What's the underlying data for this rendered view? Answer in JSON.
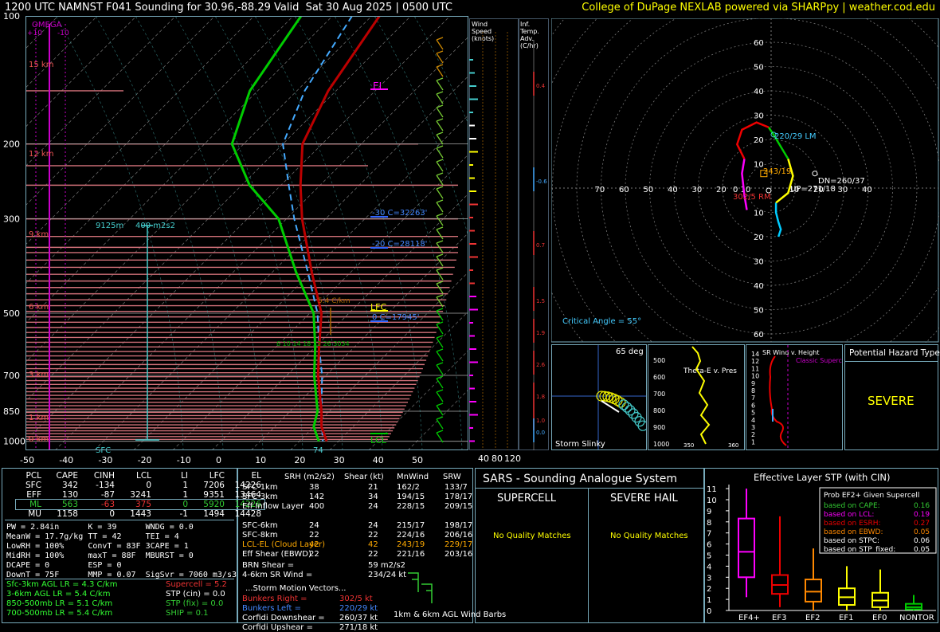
{
  "header": {
    "title": "1200 UTC NAMNST F041 Sounding for 30.96,-88.29 Valid  Sat 30 Aug 2025 | 0500 UTC",
    "credit": "College of DuPage NEXLAB powered via SHARPpy | weather.cod.edu"
  },
  "skewt": {
    "omega_label": "OMEGA",
    "omega_ticks": [
      "+10",
      "-10"
    ],
    "pressure_ticks": [
      "100",
      "200",
      "300",
      "500",
      "700",
      "850",
      "1000"
    ],
    "temp_ticks": [
      "-50",
      "-40",
      "-30",
      "-20",
      "-10",
      "0",
      "10",
      "20",
      "30",
      "40",
      "50"
    ],
    "height_labels": [
      "15 km",
      "12 km",
      "9 km",
      "6 km",
      "3 km",
      "1 km",
      "0 km"
    ],
    "annotations": {
      "el": "EL",
      "lfc": "LFC",
      "lcl": "LCL",
      "m30": "-30 C=32263'",
      "m20": "-20 C=28118'",
      "zero": "0 C=17945'",
      "lapse": "5.4 C/km",
      "eff_inflow_top": "9125m",
      "eff_inflow_srh": "400 m2s2",
      "sfc": "SFC",
      "sfc_temp": "74",
      "wet_bulb_ticks": "6  10  14  18  22 26 3034"
    },
    "temperature": [
      [
        100,
        -68
      ],
      [
        150,
        -62
      ],
      [
        200,
        -55
      ],
      [
        250,
        -45
      ],
      [
        300,
        -36
      ],
      [
        400,
        -20
      ],
      [
        500,
        -7
      ],
      [
        600,
        1
      ],
      [
        700,
        8
      ],
      [
        850,
        18
      ],
      [
        925,
        22
      ],
      [
        1000,
        27
      ]
    ],
    "dewpoint": [
      [
        100,
        -88
      ],
      [
        150,
        -82
      ],
      [
        200,
        -73
      ],
      [
        250,
        -58
      ],
      [
        300,
        -42
      ],
      [
        400,
        -24
      ],
      [
        500,
        -9
      ],
      [
        600,
        0
      ],
      [
        700,
        7
      ],
      [
        850,
        17
      ],
      [
        925,
        20
      ],
      [
        1000,
        25
      ]
    ],
    "parcel": [
      [
        100,
        -75
      ],
      [
        150,
        -68
      ],
      [
        200,
        -60
      ],
      [
        250,
        -48
      ],
      [
        300,
        -38
      ],
      [
        400,
        -21
      ],
      [
        500,
        -8
      ],
      [
        600,
        1
      ],
      [
        700,
        9
      ],
      [
        850,
        18
      ],
      [
        1000,
        26
      ]
    ]
  },
  "wind_speed_panel": {
    "label": "Wind Speed (knots)",
    "ticks": [
      "40",
      "80",
      "120"
    ]
  },
  "temp_adv_panel": {
    "label": "Inf. Temp. Adv. (C/hr)",
    "values": [
      "0.4",
      "-0.6",
      "0.7",
      "1.5",
      "1.9",
      "2.6",
      "1.8",
      "1.0",
      "0.0"
    ]
  },
  "hodograph": {
    "ring_labels": [
      "60",
      "50",
      "40",
      "30",
      "20",
      "10",
      "10",
      "20",
      "30",
      "40",
      "50",
      "60"
    ],
    "x_labels": [
      "70",
      "60",
      "50",
      "40",
      "30",
      "20",
      "10",
      "0",
      "10",
      "20",
      "30",
      "40"
    ],
    "lm": "220/29 LM",
    "storm": "243/19",
    "dn": "DN=260/37",
    "up": "UP=271/18",
    "rm": "302/5 RM",
    "critical_angle": "Critical Angle = 55°"
  },
  "slinky": {
    "angle": "65 deg",
    "label": "Storm Slinky"
  },
  "theta_panel": {
    "label": "Theta-E v. Pres",
    "ticks": [
      "500",
      "600",
      "700",
      "800",
      "900",
      "1000"
    ],
    "x": [
      "350",
      "360"
    ]
  },
  "srwind_panel": {
    "label": "SR Wind v. Height",
    "label2": "Classic Supercell",
    "ticks": [
      "14",
      "12",
      "11",
      "10",
      "9",
      "8",
      "7",
      "6",
      "5",
      "4",
      "3",
      "2",
      "1"
    ]
  },
  "hazard": {
    "title": "Potential Hazard Type",
    "value": "SEVERE"
  },
  "parcels": {
    "headers": [
      "PCL",
      "CAPE",
      "CINH",
      "LCL",
      "LI",
      "LFC",
      "EL"
    ],
    "rows": [
      [
        "SFC",
        "342",
        "-134",
        "0",
        "1",
        "7206",
        "14226"
      ],
      [
        "EFF",
        "130",
        "-87",
        "3241",
        "1",
        "9351",
        "13464"
      ],
      [
        "ML",
        "563",
        "-63",
        "375",
        "0",
        "5920",
        "14226"
      ],
      [
        "MU",
        "1158",
        "0",
        "1443",
        "-1",
        "1494",
        "14428"
      ]
    ]
  },
  "indices": [
    [
      "PW = 2.84in",
      "K = 39",
      "WNDG = 0.0"
    ],
    [
      "MeanW = 17.7g/kg",
      "TT = 42",
      "TEI = 4"
    ],
    [
      "LowRH = 100%",
      "ConvT = 83F",
      "3CAPE = 1"
    ],
    [
      "MidRH = 100%",
      "maxT = 88F",
      "MBURST = 0"
    ],
    [
      "DCAPE = 0",
      "ESP = 0",
      ""
    ],
    [
      "DownT = 75F",
      "MMP = 0.07",
      "SigSvr = 7060 m3/s3"
    ]
  ],
  "lapse": [
    "Sfc-3km AGL LR = 4.3 C/km",
    "3-6km AGL LR = 5.4 C/km",
    "850-500mb LR = 5.1 C/km",
    "700-500mb LR = 5.4 C/km"
  ],
  "composites": [
    "Supercell = 5.2",
    "STP (cin) = 0.0",
    "STP (fix) = 0.0",
    "SHIP = 0.1"
  ],
  "kinematics": {
    "headers": [
      "SRH (m2/s2)",
      "Shear (kt)",
      "MnWind",
      "SRW"
    ],
    "rows": [
      [
        "SFC-1km",
        "38",
        "21",
        "162/2",
        "133/7"
      ],
      [
        "SFC-3km",
        "142",
        "34",
        "194/15",
        "178/17"
      ],
      [
        "Eff Inflow Layer",
        "400",
        "24",
        "228/15",
        "209/15"
      ],
      [
        "",
        "",
        "",
        "",
        ""
      ],
      [
        "SFC-6km",
        "24",
        "24",
        "215/17",
        "198/17"
      ],
      [
        "SFC-8km",
        "22",
        "22",
        "224/16",
        "206/16"
      ],
      [
        "LCL-EL (Cloud Layer)",
        "42",
        "42",
        "243/19",
        "229/17"
      ],
      [
        "Eff Shear (EBWD)",
        "22",
        "22",
        "221/16",
        "203/16"
      ]
    ],
    "brn": "BRN Shear =",
    "brn_val": "59 m2/s2",
    "srwind": "4-6km SR Wind =",
    "srwind_val": "234/24 kt",
    "motion_title": "...Storm Motion Vectors...",
    "motion": [
      [
        "Bunkers Right =",
        "302/5 kt"
      ],
      [
        "Bunkers Left =",
        "220/29 kt"
      ],
      [
        "Corfidi Downshear =",
        "260/37 kt"
      ],
      [
        "Corfidi Upshear =",
        "271/18 kt"
      ]
    ],
    "barbs_label": "1km & 6km AGL Wind Barbs"
  },
  "sars": {
    "title": "SARS - Sounding Analogue System",
    "supercell": "SUPERCELL",
    "hail": "SEVERE HAIL",
    "nomatch": "No Quality Matches"
  },
  "stp": {
    "title": "Effective Layer STP (with CIN)",
    "y_ticks": [
      "11",
      "10",
      "9",
      "8",
      "7",
      "6",
      "5",
      "4",
      "3",
      "2",
      "1",
      "0"
    ],
    "categories": [
      "EF4+",
      "EF3",
      "EF2",
      "EF1",
      "EF0",
      "NONTOR"
    ],
    "legend_title": "Prob EF2+ Given Supercell",
    "legend": [
      [
        "based on CAPE:",
        "0.16"
      ],
      [
        "based on LCL:",
        "0.19"
      ],
      [
        "based on ESRH:",
        "0.27"
      ],
      [
        "based on EBWD:",
        "0.05"
      ],
      [
        "based on STPC:",
        "0.06"
      ],
      [
        "based on STP_fixed:",
        "0.05"
      ]
    ]
  },
  "chart_data": {
    "type": "box",
    "title": "Effective Layer STP (with CIN)",
    "categories": [
      "EF4+",
      "EF3",
      "EF2",
      "EF1",
      "EF0",
      "NONTOR"
    ],
    "boxes": [
      {
        "min": 1.2,
        "q1": 3.0,
        "median": 5.3,
        "q3": 8.3,
        "max": 11.0
      },
      {
        "min": 0.3,
        "q1": 1.5,
        "median": 2.3,
        "q3": 3.2,
        "max": 8.5
      },
      {
        "min": 0.0,
        "q1": 0.8,
        "median": 1.7,
        "q3": 2.8,
        "max": 5.6
      },
      {
        "min": 0.0,
        "q1": 0.5,
        "median": 1.2,
        "q3": 2.0,
        "max": 4.0
      },
      {
        "min": 0.0,
        "q1": 0.3,
        "median": 0.9,
        "q3": 1.6,
        "max": 3.7
      },
      {
        "min": 0.0,
        "q1": 0.1,
        "median": 0.3,
        "q3": 0.6,
        "max": 1.4
      }
    ],
    "ylim": [
      0,
      11
    ]
  }
}
